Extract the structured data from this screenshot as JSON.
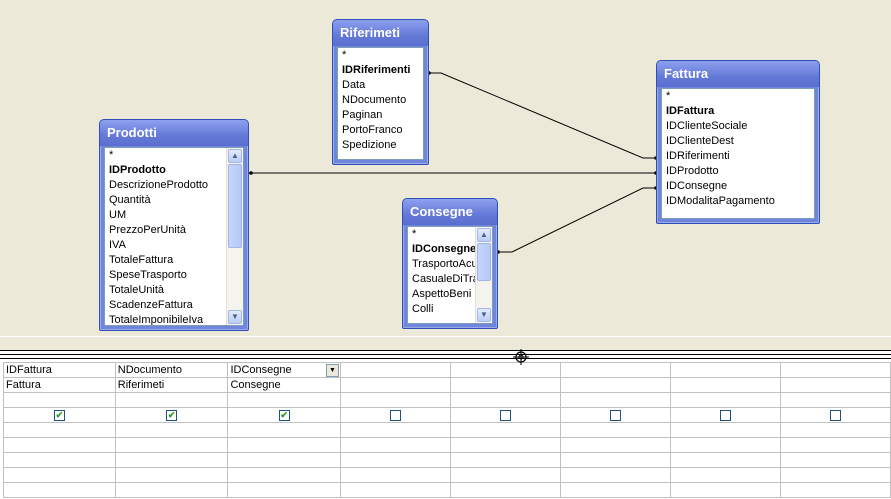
{
  "tables": {
    "riferimeti": {
      "title": "Riferimeti",
      "fields": [
        "*",
        "IDRiferimenti",
        "Data",
        "NDocumento",
        "Paginan",
        "PortoFranco",
        "Spedizione"
      ]
    },
    "fattura": {
      "title": "Fattura",
      "fields": [
        "*",
        "IDFattura",
        "IDClienteSociale",
        "IDClienteDest",
        "IDRiferimenti",
        "IDProdotto",
        "IDConsegne",
        "IDModalitaPagamento"
      ]
    },
    "prodotti": {
      "title": "Prodotti",
      "fields": [
        "*",
        "IDProdotto",
        "DescrizioneProdotto",
        "Quantità",
        "UM",
        "PrezzoPerUnità",
        "IVA",
        "TotaleFattura",
        "SpeseTrasporto",
        "TotaleUnità",
        "ScadenzeFattura",
        "TotaleImponibileIva"
      ]
    },
    "consegne": {
      "title": "Consegne",
      "fields": [
        "*",
        "IDConsegne",
        "TrasportoAcurra",
        "CasualeDiTrasporto",
        "AspettoBeni",
        "Colli"
      ]
    }
  },
  "grid": {
    "columns": [
      {
        "field": "IDFattura",
        "table": "Fattura",
        "show": true
      },
      {
        "field": "NDocumento",
        "table": "Riferimeti",
        "show": true
      },
      {
        "field": "IDConsegne",
        "table": "Consegne",
        "show": true
      },
      {
        "field": "",
        "table": "",
        "show": false
      },
      {
        "field": "",
        "table": "",
        "show": false
      },
      {
        "field": "",
        "table": "",
        "show": false
      },
      {
        "field": "",
        "table": "",
        "show": false
      },
      {
        "field": "",
        "table": "",
        "show": false
      }
    ]
  },
  "icons": {
    "scroll_up": "▲",
    "scroll_down": "▼",
    "dropdown": "▼",
    "check": "✔"
  }
}
